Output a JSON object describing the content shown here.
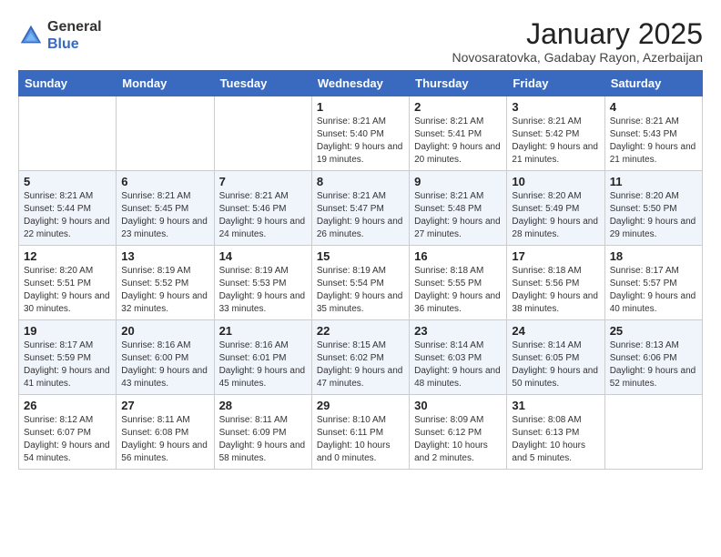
{
  "logo": {
    "line1": "General",
    "line2": "Blue"
  },
  "title": "January 2025",
  "subtitle": "Novosaratovka, Gadabay Rayon, Azerbaijan",
  "days_of_week": [
    "Sunday",
    "Monday",
    "Tuesday",
    "Wednesday",
    "Thursday",
    "Friday",
    "Saturday"
  ],
  "weeks": [
    [
      {
        "num": "",
        "info": ""
      },
      {
        "num": "",
        "info": ""
      },
      {
        "num": "",
        "info": ""
      },
      {
        "num": "1",
        "info": "Sunrise: 8:21 AM\nSunset: 5:40 PM\nDaylight: 9 hours and 19 minutes."
      },
      {
        "num": "2",
        "info": "Sunrise: 8:21 AM\nSunset: 5:41 PM\nDaylight: 9 hours and 20 minutes."
      },
      {
        "num": "3",
        "info": "Sunrise: 8:21 AM\nSunset: 5:42 PM\nDaylight: 9 hours and 21 minutes."
      },
      {
        "num": "4",
        "info": "Sunrise: 8:21 AM\nSunset: 5:43 PM\nDaylight: 9 hours and 21 minutes."
      }
    ],
    [
      {
        "num": "5",
        "info": "Sunrise: 8:21 AM\nSunset: 5:44 PM\nDaylight: 9 hours and 22 minutes."
      },
      {
        "num": "6",
        "info": "Sunrise: 8:21 AM\nSunset: 5:45 PM\nDaylight: 9 hours and 23 minutes."
      },
      {
        "num": "7",
        "info": "Sunrise: 8:21 AM\nSunset: 5:46 PM\nDaylight: 9 hours and 24 minutes."
      },
      {
        "num": "8",
        "info": "Sunrise: 8:21 AM\nSunset: 5:47 PM\nDaylight: 9 hours and 26 minutes."
      },
      {
        "num": "9",
        "info": "Sunrise: 8:21 AM\nSunset: 5:48 PM\nDaylight: 9 hours and 27 minutes."
      },
      {
        "num": "10",
        "info": "Sunrise: 8:20 AM\nSunset: 5:49 PM\nDaylight: 9 hours and 28 minutes."
      },
      {
        "num": "11",
        "info": "Sunrise: 8:20 AM\nSunset: 5:50 PM\nDaylight: 9 hours and 29 minutes."
      }
    ],
    [
      {
        "num": "12",
        "info": "Sunrise: 8:20 AM\nSunset: 5:51 PM\nDaylight: 9 hours and 30 minutes."
      },
      {
        "num": "13",
        "info": "Sunrise: 8:19 AM\nSunset: 5:52 PM\nDaylight: 9 hours and 32 minutes."
      },
      {
        "num": "14",
        "info": "Sunrise: 8:19 AM\nSunset: 5:53 PM\nDaylight: 9 hours and 33 minutes."
      },
      {
        "num": "15",
        "info": "Sunrise: 8:19 AM\nSunset: 5:54 PM\nDaylight: 9 hours and 35 minutes."
      },
      {
        "num": "16",
        "info": "Sunrise: 8:18 AM\nSunset: 5:55 PM\nDaylight: 9 hours and 36 minutes."
      },
      {
        "num": "17",
        "info": "Sunrise: 8:18 AM\nSunset: 5:56 PM\nDaylight: 9 hours and 38 minutes."
      },
      {
        "num": "18",
        "info": "Sunrise: 8:17 AM\nSunset: 5:57 PM\nDaylight: 9 hours and 40 minutes."
      }
    ],
    [
      {
        "num": "19",
        "info": "Sunrise: 8:17 AM\nSunset: 5:59 PM\nDaylight: 9 hours and 41 minutes."
      },
      {
        "num": "20",
        "info": "Sunrise: 8:16 AM\nSunset: 6:00 PM\nDaylight: 9 hours and 43 minutes."
      },
      {
        "num": "21",
        "info": "Sunrise: 8:16 AM\nSunset: 6:01 PM\nDaylight: 9 hours and 45 minutes."
      },
      {
        "num": "22",
        "info": "Sunrise: 8:15 AM\nSunset: 6:02 PM\nDaylight: 9 hours and 47 minutes."
      },
      {
        "num": "23",
        "info": "Sunrise: 8:14 AM\nSunset: 6:03 PM\nDaylight: 9 hours and 48 minutes."
      },
      {
        "num": "24",
        "info": "Sunrise: 8:14 AM\nSunset: 6:05 PM\nDaylight: 9 hours and 50 minutes."
      },
      {
        "num": "25",
        "info": "Sunrise: 8:13 AM\nSunset: 6:06 PM\nDaylight: 9 hours and 52 minutes."
      }
    ],
    [
      {
        "num": "26",
        "info": "Sunrise: 8:12 AM\nSunset: 6:07 PM\nDaylight: 9 hours and 54 minutes."
      },
      {
        "num": "27",
        "info": "Sunrise: 8:11 AM\nSunset: 6:08 PM\nDaylight: 9 hours and 56 minutes."
      },
      {
        "num": "28",
        "info": "Sunrise: 8:11 AM\nSunset: 6:09 PM\nDaylight: 9 hours and 58 minutes."
      },
      {
        "num": "29",
        "info": "Sunrise: 8:10 AM\nSunset: 6:11 PM\nDaylight: 10 hours and 0 minutes."
      },
      {
        "num": "30",
        "info": "Sunrise: 8:09 AM\nSunset: 6:12 PM\nDaylight: 10 hours and 2 minutes."
      },
      {
        "num": "31",
        "info": "Sunrise: 8:08 AM\nSunset: 6:13 PM\nDaylight: 10 hours and 5 minutes."
      },
      {
        "num": "",
        "info": ""
      }
    ]
  ]
}
